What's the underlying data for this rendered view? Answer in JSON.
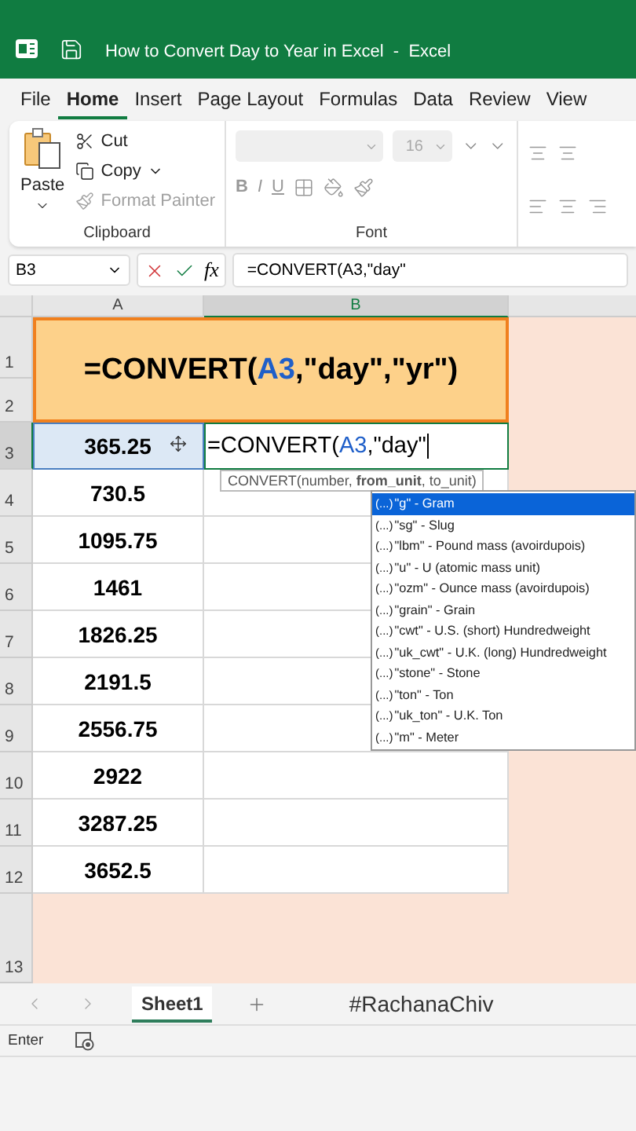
{
  "title_bar": {
    "title": "How to Convert Day to Year in Excel  -  Excel"
  },
  "ribbon_tabs": [
    {
      "label": "File",
      "selected": false
    },
    {
      "label": "Home",
      "selected": true
    },
    {
      "label": "Insert",
      "selected": false
    },
    {
      "label": "Page Layout",
      "selected": false
    },
    {
      "label": "Formulas",
      "selected": false
    },
    {
      "label": "Data",
      "selected": false
    },
    {
      "label": "Review",
      "selected": false
    },
    {
      "label": "View",
      "selected": false
    }
  ],
  "clipboard": {
    "paste": "Paste",
    "cut": "Cut",
    "copy": "Copy",
    "format_painter": "Format Painter",
    "format_painter_disabled": true,
    "group_label": "Clipboard"
  },
  "font": {
    "size": "16",
    "bold": "B",
    "italic": "I",
    "underline": "U",
    "group_label": "Font"
  },
  "formula_bar": {
    "name_box": "B3",
    "fx": "fx",
    "formula": "=CONVERT(A3,\"day\""
  },
  "columns": [
    {
      "label": "A",
      "selected": false
    },
    {
      "label": "B",
      "selected": true
    }
  ],
  "row_headers": [
    {
      "label": "1",
      "selected": false
    },
    {
      "label": "2",
      "selected": false
    },
    {
      "label": "3",
      "selected": true
    },
    {
      "label": "4",
      "selected": false
    },
    {
      "label": "5",
      "selected": false
    },
    {
      "label": "6",
      "selected": false
    },
    {
      "label": "7",
      "selected": false
    },
    {
      "label": "8",
      "selected": false
    },
    {
      "label": "9",
      "selected": false
    },
    {
      "label": "10",
      "selected": false
    },
    {
      "label": "11",
      "selected": false
    },
    {
      "label": "12",
      "selected": false
    },
    {
      "label": "13",
      "selected": false
    }
  ],
  "header_cell": [
    {
      "kind": "text",
      "text": "=CONVERT("
    },
    {
      "kind": "ref",
      "text": "A3"
    },
    {
      "kind": "text",
      "text": ",\"day\",\"yr\")"
    }
  ],
  "values": [
    {
      "text": "365.25",
      "referenced": true
    },
    {
      "text": "730.5",
      "referenced": false
    },
    {
      "text": "1095.75",
      "referenced": false
    },
    {
      "text": "1461",
      "referenced": false
    },
    {
      "text": "1826.25",
      "referenced": false
    },
    {
      "text": "2191.5",
      "referenced": false
    },
    {
      "text": "2556.75",
      "referenced": false
    },
    {
      "text": "2922",
      "referenced": false
    },
    {
      "text": "3287.25",
      "referenced": false
    },
    {
      "text": "3652.5",
      "referenced": false
    }
  ],
  "edit_cell": [
    {
      "kind": "text",
      "text": "=CONVERT("
    },
    {
      "kind": "ref",
      "text": "A3"
    },
    {
      "kind": "text",
      "text": ",\"day\""
    }
  ],
  "tooltip": "CONVERT(number, **from_unit**, to_unit)",
  "autocomplete": [
    {
      "marker": "(...)",
      "label": "\"g\" - Gram",
      "selected": true
    },
    {
      "marker": "(...)",
      "label": "\"sg\" - Slug",
      "selected": false
    },
    {
      "marker": "(...)",
      "label": "\"lbm\" - Pound mass (avoirdupois)",
      "selected": false
    },
    {
      "marker": "(...)",
      "label": "\"u\" - U (atomic mass unit)",
      "selected": false
    },
    {
      "marker": "(...)",
      "label": "\"ozm\" - Ounce mass (avoirdupois)",
      "selected": false
    },
    {
      "marker": "(...)",
      "label": "\"grain\" - Grain",
      "selected": false
    },
    {
      "marker": "(...)",
      "label": "\"cwt\" - U.S. (short) Hundredweight",
      "selected": false
    },
    {
      "marker": "(...)",
      "label": "\"uk_cwt\" - U.K. (long) Hundredweight",
      "selected": false
    },
    {
      "marker": "(...)",
      "label": "\"stone\" - Stone",
      "selected": false
    },
    {
      "marker": "(...)",
      "label": "\"ton\" - Ton",
      "selected": false
    },
    {
      "marker": "(...)",
      "label": "\"uk_ton\" - U.K. Ton",
      "selected": false
    },
    {
      "marker": "(...)",
      "label": "\"m\" - Meter",
      "selected": false
    }
  ],
  "sheet_tabs": [
    {
      "label": "Sheet1",
      "selected": true
    }
  ],
  "channel_tag": "#RachanaChiv",
  "status_bar": {
    "mode": "Enter"
  }
}
